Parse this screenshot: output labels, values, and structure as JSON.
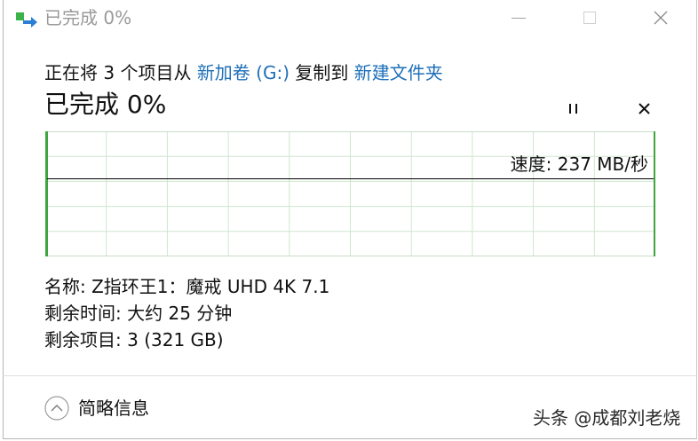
{
  "window": {
    "title": "已完成 0%",
    "icon": "copy-progress-icon",
    "controls": {
      "minimize_icon": "minimize-icon",
      "maximize_icon": "maximize-icon",
      "close_icon": "close-icon"
    }
  },
  "operation": {
    "prefix": "正在将 3 个项目从",
    "source": "新加卷 (G:)",
    "middle": "复制到",
    "destination": "新建文件夹"
  },
  "progress": {
    "heading": "已完成 0%",
    "percent_complete": 0,
    "pause_icon": "pause-icon",
    "cancel_icon": "close-icon"
  },
  "speed_graph": {
    "speed_label": "速度: 237 MB/秒"
  },
  "details": [
    {
      "label": "名称:",
      "value": "Z指环王1：魔戒 UHD 4K 7.1"
    },
    {
      "label": "剩余时间:",
      "value": "大约 25 分钟"
    },
    {
      "label": "剩余项目:",
      "value": "3 (321 GB)"
    }
  ],
  "footer": {
    "toggle_label": "简略信息",
    "toggle_icon": "chevron-up-circle-icon"
  },
  "watermark": "头条 @成都刘老烧",
  "colors": {
    "link": "#1e6fb8",
    "graph_accent": "#3fa63f",
    "graph_grid": "#cfe6cf",
    "title_inactive": "#9a9a9a"
  }
}
